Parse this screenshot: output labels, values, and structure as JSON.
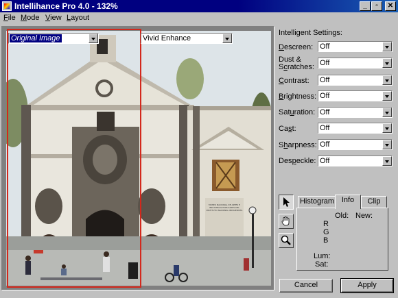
{
  "window": {
    "title": "Intellihance Pro 4.0 - 132%"
  },
  "menu": [
    {
      "mnemonic": "F",
      "rest": "ile"
    },
    {
      "mnemonic": "M",
      "rest": "ode"
    },
    {
      "mnemonic": "V",
      "rest": "iew"
    },
    {
      "mnemonic": "L",
      "rest": "ayout"
    }
  ],
  "viewer": {
    "left_preset": "Original Image",
    "right_preset": "Vivid Enhance",
    "sign_text": "MUSEO NACIONAL DE ARTES E INDUSTRIAS POPULARES DEL INSTITUTO NACIONAL INDIGENISTA"
  },
  "settings": {
    "title": "Intelligent Settings:",
    "items": [
      {
        "pre": "",
        "mnemonic": "D",
        "post": "escreen:",
        "value": "Off"
      },
      {
        "pre": "Dust &",
        "mnemonic": "",
        "post": "",
        "line2_pre": "S",
        "line2_mnemonic": "c",
        "line2_post": "ratches:",
        "value": "Off"
      },
      {
        "pre": "",
        "mnemonic": "C",
        "post": "ontrast:",
        "value": "Off"
      },
      {
        "pre": "",
        "mnemonic": "B",
        "post": "rightness:",
        "value": "Off"
      },
      {
        "pre": "Sat",
        "mnemonic": "u",
        "post": "ration:",
        "value": "Off"
      },
      {
        "pre": "Ca",
        "mnemonic": "s",
        "post": "t:",
        "value": "Off"
      },
      {
        "pre": "S",
        "mnemonic": "h",
        "post": "arpness:",
        "value": "Off"
      },
      {
        "pre": "Des",
        "mnemonic": "p",
        "post": "eckle:",
        "value": "Off"
      }
    ]
  },
  "tools": [
    "arrow-pointer",
    "hand",
    "magnifier"
  ],
  "tabs": {
    "histogram": "Histogram",
    "info": "Info",
    "clip": "Clip"
  },
  "info": {
    "old": "Old:",
    "new": "New:",
    "r": "R",
    "g": "G",
    "b": "B",
    "lum": "Lum:",
    "sat": "Sat:"
  },
  "buttons": {
    "cancel": "Cancel",
    "apply": "Apply"
  },
  "colors": {
    "title_bar": "#000080",
    "face": "#c0c0c0",
    "selection_frame": "#d3281c",
    "highlight": "#000080"
  }
}
